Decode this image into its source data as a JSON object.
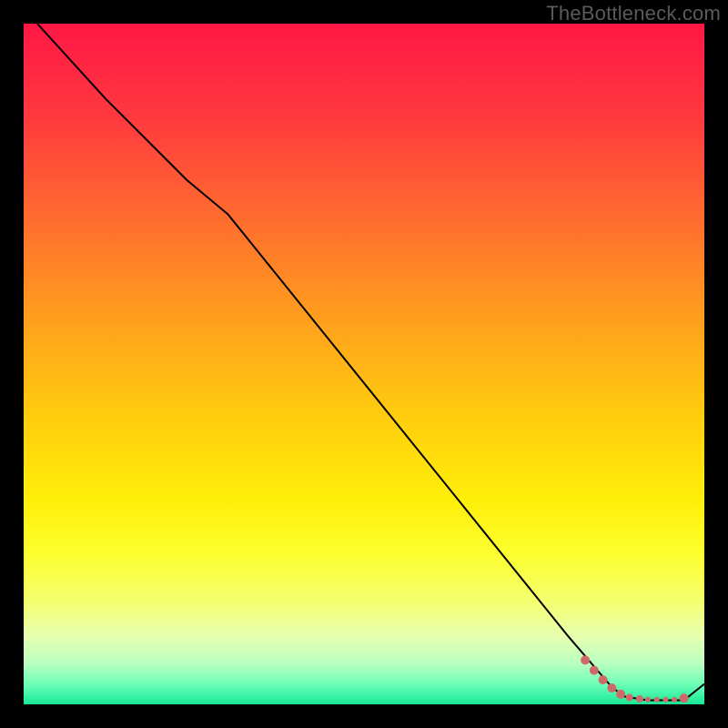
{
  "watermark": "TheBottleneck.com",
  "gradient": {
    "stops": [
      {
        "offset": "0%",
        "color": "#ff1745"
      },
      {
        "offset": "14%",
        "color": "#ff3a3f"
      },
      {
        "offset": "28%",
        "color": "#ff6a2f"
      },
      {
        "offset": "42%",
        "color": "#ff9a1f"
      },
      {
        "offset": "56%",
        "color": "#ffc80f"
      },
      {
        "offset": "70%",
        "color": "#ffef09"
      },
      {
        "offset": "78%",
        "color": "#fcff30"
      },
      {
        "offset": "85%",
        "color": "#f4ff70"
      },
      {
        "offset": "90%",
        "color": "#e7ffb0"
      },
      {
        "offset": "94%",
        "color": "#b8ffc0"
      },
      {
        "offset": "97%",
        "color": "#70ffb8"
      },
      {
        "offset": "100%",
        "color": "#17e896"
      }
    ]
  },
  "chart_data": {
    "type": "line",
    "title": "",
    "xlabel": "",
    "ylabel": "",
    "xlim": [
      0,
      100
    ],
    "ylim": [
      0,
      100
    ],
    "series": [
      {
        "name": "bottleneck-curve",
        "x": [
          2,
          12,
          24,
          30,
          80,
          86,
          88,
          91,
          92,
          94,
          95,
          97,
          100
        ],
        "y": [
          100,
          89,
          77,
          72,
          10,
          3,
          1.2,
          0.7,
          0.6,
          0.6,
          0.6,
          0.6,
          3
        ]
      }
    ],
    "markers": {
      "name": "highlight-range",
      "color": "#d06a6a",
      "points": [
        {
          "x": 82.5,
          "y": 6.5,
          "r": 5
        },
        {
          "x": 83.8,
          "y": 5.0,
          "r": 5
        },
        {
          "x": 85.1,
          "y": 3.6,
          "r": 5
        },
        {
          "x": 86.4,
          "y": 2.4,
          "r": 5
        },
        {
          "x": 87.7,
          "y": 1.5,
          "r": 5
        },
        {
          "x": 89.0,
          "y": 1.0,
          "r": 4
        },
        {
          "x": 90.5,
          "y": 0.8,
          "r": 4
        },
        {
          "x": 91.7,
          "y": 0.7,
          "r": 3
        },
        {
          "x": 93.0,
          "y": 0.7,
          "r": 3
        },
        {
          "x": 94.3,
          "y": 0.7,
          "r": 3
        },
        {
          "x": 95.6,
          "y": 0.7,
          "r": 3
        },
        {
          "x": 97.0,
          "y": 0.9,
          "r": 5
        }
      ]
    }
  }
}
